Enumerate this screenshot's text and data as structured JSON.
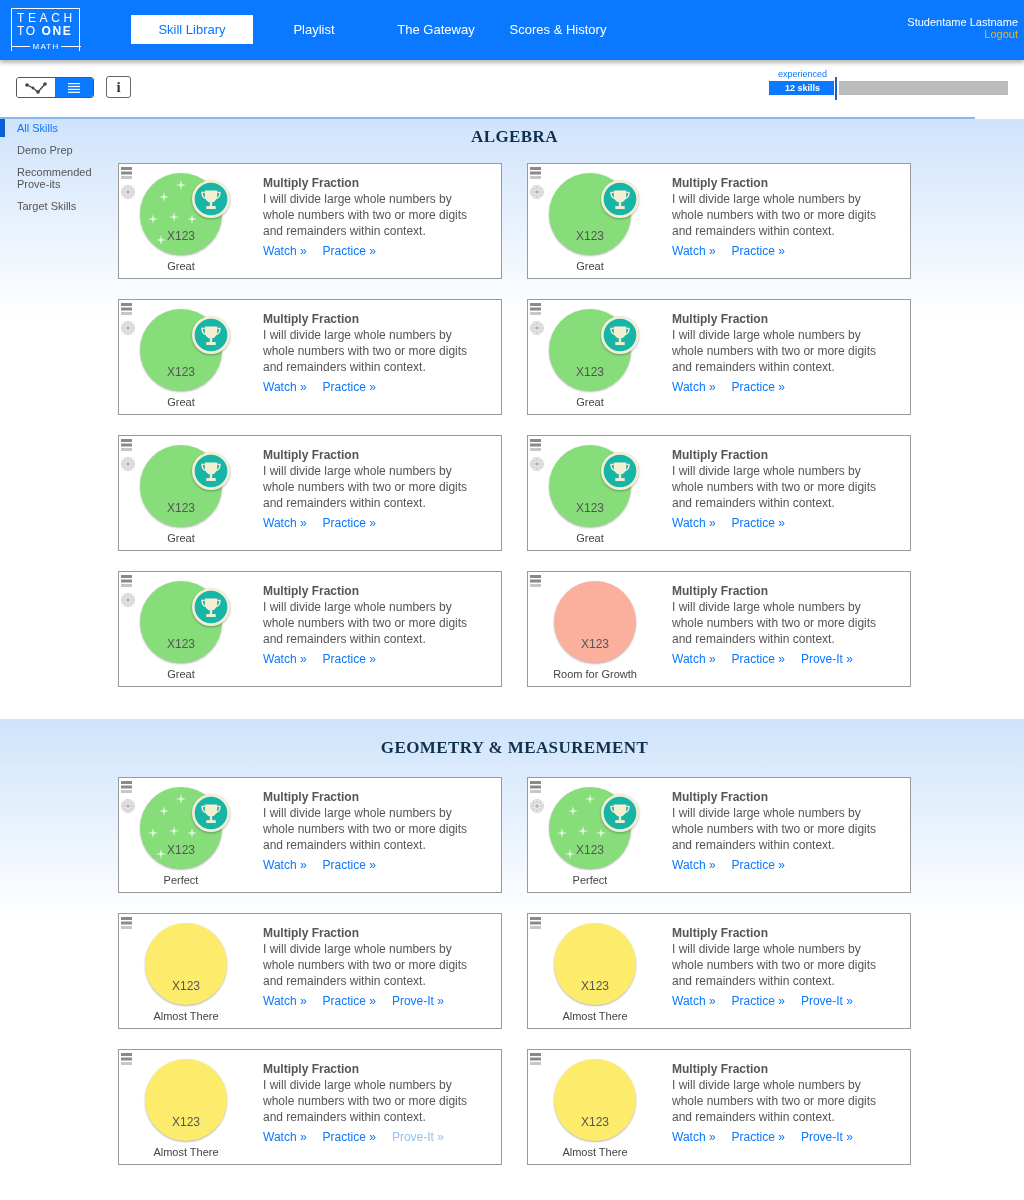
{
  "header": {
    "logo": {
      "line_1": "TEACH",
      "line_2": "TO **ONE**",
      "line_3": "MATH"
    },
    "nav": [
      {
        "label": "Skill Library",
        "selected": true
      },
      {
        "label": "Playlist",
        "selected": false
      },
      {
        "label": "The Gateway",
        "selected": false
      },
      {
        "label": "Scores & History",
        "selected": false
      }
    ],
    "user": {
      "name": "Studentame Lastname",
      "logout": "Logout"
    }
  },
  "toolbar": {
    "view_toggle": [
      {
        "kind": "graph",
        "selected": false
      },
      {
        "kind": "list",
        "selected": true
      }
    ],
    "info_button": "i",
    "progress": {
      "label": "experienced",
      "reading": "12 skills",
      "level": 0.28
    }
  },
  "sidebar": {
    "items": [
      {
        "label": "All Skills",
        "selected": true
      },
      {
        "label": "Demo Prep",
        "selected": false
      },
      {
        "label": "Recommended Prove-its",
        "selected": false
      },
      {
        "label": "Target Skills",
        "selected": false
      }
    ]
  },
  "sections": [
    {
      "title": "ALGEBRA",
      "cards": [
        {
          "title": "Multiply Fraction",
          "description": "I will divide large whole numbers by whole numbers with two or more digits and remainders within context.",
          "skill_code": "X123",
          "status": "Great",
          "color": "#88dd7b",
          "trophy": true,
          "seal": true,
          "sparkles": true,
          "links": [
            {
              "label": "Watch »",
              "disabled": false
            },
            {
              "label": "Practice »",
              "disabled": false
            }
          ]
        },
        {
          "title": "Multiply Fraction",
          "description": "I will divide large whole numbers by whole numbers with two or more digits and remainders within context.",
          "skill_code": "X123",
          "status": "Great",
          "color": "#88dd7b",
          "trophy": true,
          "seal": true,
          "sparkles": false,
          "links": [
            {
              "label": "Watch »",
              "disabled": false
            },
            {
              "label": "Practice »",
              "disabled": false
            }
          ]
        },
        {
          "title": "Multiply Fraction",
          "description": "I will divide large whole numbers by whole numbers with two or more digits and remainders within context.",
          "skill_code": "X123",
          "status": "Great",
          "color": "#88dd7b",
          "trophy": true,
          "seal": true,
          "sparkles": false,
          "links": [
            {
              "label": "Watch »",
              "disabled": false
            },
            {
              "label": "Practice »",
              "disabled": false
            }
          ]
        },
        {
          "title": "Multiply Fraction",
          "description": "I will divide large whole numbers by whole numbers with two or more digits and remainders within context.",
          "skill_code": "X123",
          "status": "Great",
          "color": "#88dd7b",
          "trophy": true,
          "seal": true,
          "sparkles": false,
          "links": [
            {
              "label": "Watch »",
              "disabled": false
            },
            {
              "label": "Practice »",
              "disabled": false
            }
          ]
        },
        {
          "title": "Multiply Fraction",
          "description": "I will divide large whole numbers by whole numbers with two or more digits and remainders within context.",
          "skill_code": "X123",
          "status": "Great",
          "color": "#88dd7b",
          "trophy": true,
          "seal": true,
          "sparkles": false,
          "links": [
            {
              "label": "Watch »",
              "disabled": false
            },
            {
              "label": "Practice »",
              "disabled": false
            }
          ]
        },
        {
          "title": "Multiply Fraction",
          "description": "I will divide large whole numbers by whole numbers with two or more digits and remainders within context.",
          "skill_code": "X123",
          "status": "Great",
          "color": "#88dd7b",
          "trophy": true,
          "seal": true,
          "sparkles": false,
          "links": [
            {
              "label": "Watch »",
              "disabled": false
            },
            {
              "label": "Practice »",
              "disabled": false
            }
          ]
        },
        {
          "title": "Multiply Fraction",
          "description": "I will divide large whole numbers by whole numbers with two or more digits and remainders within context.",
          "skill_code": "X123",
          "status": "Great",
          "color": "#88dd7b",
          "trophy": true,
          "seal": true,
          "sparkles": false,
          "links": [
            {
              "label": "Watch »",
              "disabled": false
            },
            {
              "label": "Practice »",
              "disabled": false
            }
          ]
        },
        {
          "title": "Multiply Fraction",
          "description": "I will divide large whole numbers by whole numbers with two or more digits and remainders within context.",
          "skill_code": "X123",
          "status": "Room for Growth",
          "color": "#fbb09e",
          "trophy": false,
          "seal": false,
          "sparkles": false,
          "links": [
            {
              "label": "Watch »",
              "disabled": false
            },
            {
              "label": "Practice »",
              "disabled": false
            },
            {
              "label": "Prove-It »",
              "disabled": false
            }
          ]
        }
      ]
    },
    {
      "title": "GEOMETRY & MEASUREMENT",
      "cards": [
        {
          "title": "Multiply Fraction",
          "description": "I will divide large whole numbers by whole numbers with two or more digits and remainders within context.",
          "skill_code": "X123",
          "status": "Perfect",
          "color": "#88dd7b",
          "trophy": true,
          "seal": true,
          "sparkles": true,
          "links": [
            {
              "label": "Watch »",
              "disabled": false
            },
            {
              "label": "Practice »",
              "disabled": false
            }
          ]
        },
        {
          "title": "Multiply Fraction",
          "description": "I will divide large whole numbers by whole numbers with two or more digits and remainders within context.",
          "skill_code": "X123",
          "status": "Perfect",
          "color": "#88dd7b",
          "trophy": true,
          "seal": true,
          "sparkles": true,
          "links": [
            {
              "label": "Watch »",
              "disabled": false
            },
            {
              "label": "Practice »",
              "disabled": false
            }
          ]
        },
        {
          "title": "Multiply Fraction",
          "description": "I will divide large whole numbers by whole numbers with two or more digits and remainders within context.",
          "skill_code": "X123",
          "status": "Almost There",
          "color": "#fdec6b",
          "trophy": false,
          "seal": false,
          "sparkles": false,
          "links": [
            {
              "label": "Watch »",
              "disabled": false
            },
            {
              "label": "Practice »",
              "disabled": false
            },
            {
              "label": "Prove-It »",
              "disabled": false
            }
          ]
        },
        {
          "title": "Multiply Fraction",
          "description": "I will divide large whole numbers by whole numbers with two or more digits and remainders within context.",
          "skill_code": "X123",
          "status": "Almost There",
          "color": "#fdec6b",
          "trophy": false,
          "seal": false,
          "sparkles": false,
          "links": [
            {
              "label": "Watch »",
              "disabled": false
            },
            {
              "label": "Practice »",
              "disabled": false
            },
            {
              "label": "Prove-It »",
              "disabled": false
            }
          ]
        },
        {
          "title": "Multiply Fraction",
          "description": "I will divide large whole numbers by whole numbers with two or more digits and remainders within context.",
          "skill_code": "X123",
          "status": "Almost There",
          "color": "#fdec6b",
          "trophy": false,
          "seal": false,
          "sparkles": false,
          "links": [
            {
              "label": "Watch »",
              "disabled": false
            },
            {
              "label": "Practice »",
              "disabled": false
            },
            {
              "label": "Prove-It »",
              "disabled": true
            }
          ]
        },
        {
          "title": "Multiply Fraction",
          "description": "I will divide large whole numbers by whole numbers with two or more digits and remainders within context.",
          "skill_code": "X123",
          "status": "Almost There",
          "color": "#fdec6b",
          "trophy": false,
          "seal": false,
          "sparkles": false,
          "links": [
            {
              "label": "Watch »",
              "disabled": false
            },
            {
              "label": "Practice »",
              "disabled": false
            },
            {
              "label": "Prove-It »",
              "disabled": false
            }
          ]
        }
      ]
    }
  ]
}
